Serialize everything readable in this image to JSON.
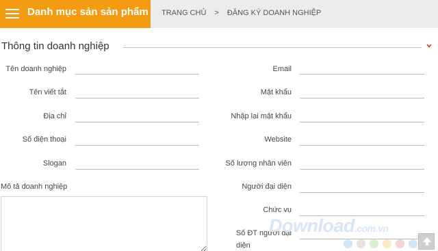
{
  "header": {
    "menu_title": "Danh mục sản sản phẩm",
    "breadcrumb": {
      "home": "TRANG CHỦ",
      "separator": ">",
      "current": "ĐĂNG KÝ DOANH NGHIỆP"
    }
  },
  "section": {
    "title": "Thông tin doanh nghiệp"
  },
  "form": {
    "left": {
      "company_name": "Tên doanh nghiệp",
      "short_name": "Tên viết tắt",
      "address": "Địa chỉ",
      "phone": "Số điện thoại",
      "slogan": "Slogan",
      "description": "Mô tả doanh nghiệp"
    },
    "right": {
      "email": "Email",
      "password": "Mật khẩu",
      "confirm_password": "Nhập lại mật khẩu",
      "website": "Website",
      "employees": "Số lượng nhân viên",
      "representative": "Người đại diện",
      "position": "Chức vụ",
      "rep_phone_line1": "Số ĐT người đại",
      "rep_phone_line2": "diện"
    }
  },
  "watermark": {
    "text": "Download",
    "domain": ".com.vn"
  },
  "colors": {
    "accent": "#f39c12",
    "topbar": "#ececec",
    "chevron": "#c0392b"
  },
  "icons": {
    "menu": "hamburger-icon",
    "collapse": "chevron-down-icon",
    "scroll": "arrow-up-icon"
  }
}
